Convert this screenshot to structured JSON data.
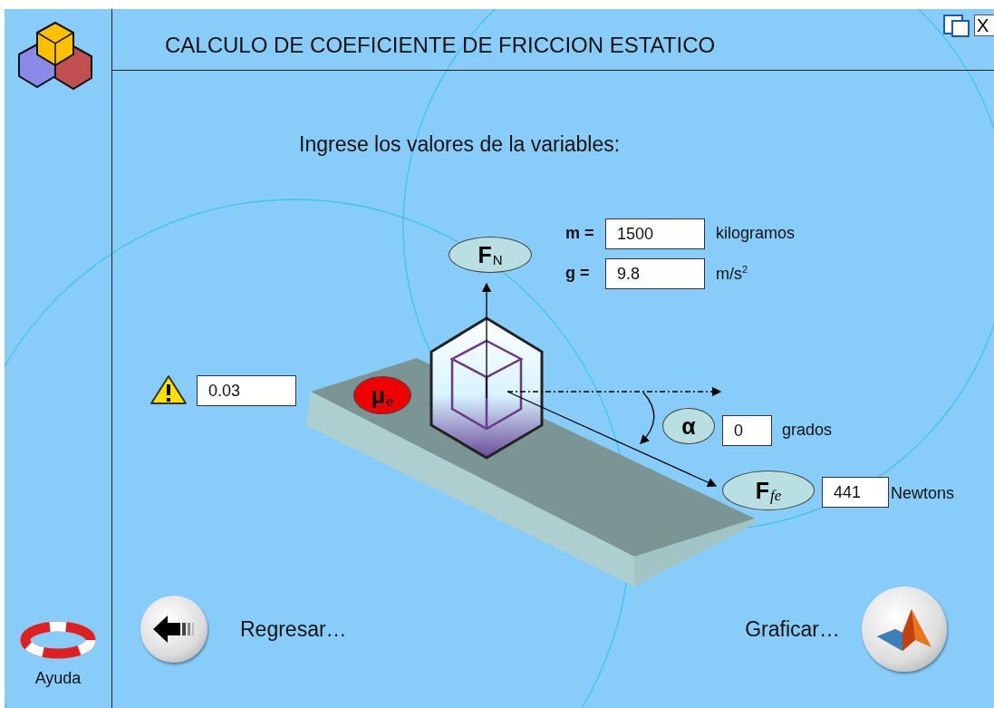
{
  "window": {
    "title": "CALCULO DE COEFICIENTE DE FRICCION ESTATICO",
    "close_label": "X"
  },
  "prompt": "Ingrese los valores de la variables:",
  "inputs": [
    {
      "label": "m =",
      "value": "1500",
      "unit": "kilogramos"
    },
    {
      "label": "g =",
      "value": "9.8",
      "unit": "m/s$^{2}$"
    }
  ],
  "normal_force": {
    "symbol": "F$_{N}$"
  },
  "friction": {
    "symbol": "μ$_{e}$",
    "value": "0.03"
  },
  "angle": {
    "symbol": "α",
    "value": "0",
    "unit": "grados"
  },
  "friction_force": {
    "symbol": "F$_{fe}$",
    "value": "441",
    "unit": "Newtons"
  },
  "buttons": [
    {
      "kind": "back",
      "label": "Regresar…"
    },
    {
      "kind": "plot",
      "label": "Graficar…"
    }
  ],
  "help": {
    "label": "Ayuda"
  }
}
